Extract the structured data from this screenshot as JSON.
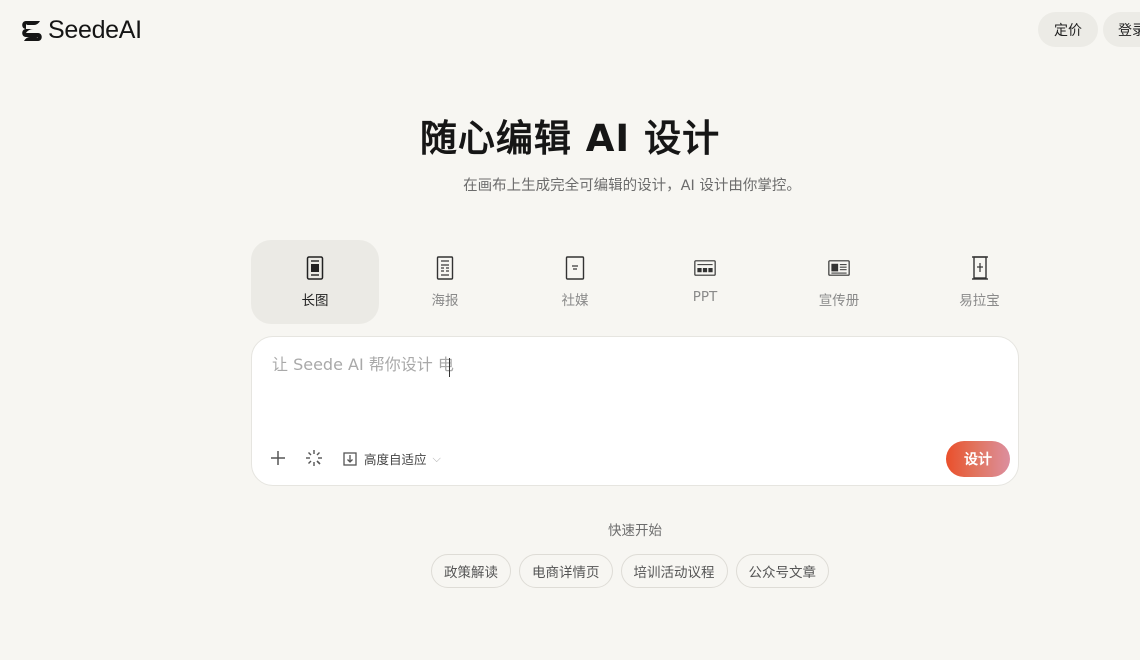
{
  "header": {
    "logo_text": "SeedeAI",
    "nav": {
      "pricing": "定价",
      "login": "登录"
    }
  },
  "hero": {
    "title": "随心编辑 AI 设计",
    "subtitle": "在画布上生成完全可编辑的设计，AI 设计由你掌控。"
  },
  "tabs": [
    {
      "label": "长图",
      "icon": "long-image-icon",
      "active": true
    },
    {
      "label": "海报",
      "icon": "poster-icon",
      "active": false
    },
    {
      "label": "社媒",
      "icon": "social-media-icon",
      "active": false
    },
    {
      "label": "PPT",
      "icon": "ppt-icon",
      "active": false
    },
    {
      "label": "宣传册",
      "icon": "brochure-icon",
      "active": false
    },
    {
      "label": "易拉宝",
      "icon": "rollup-banner-icon",
      "active": false
    }
  ],
  "prompt": {
    "placeholder": "让 Seede AI 帮你设计 电",
    "value": "",
    "height_mode": "高度自适应",
    "submit_label": "设计"
  },
  "quick_start": {
    "title": "快速开始",
    "chips": [
      "政策解读",
      "电商详情页",
      "培训活动议程",
      "公众号文章"
    ]
  },
  "colors": {
    "background": "#f7f6f2",
    "accent_gradient_start": "#ea4f2b",
    "accent_gradient_end": "#dc8f9f"
  }
}
